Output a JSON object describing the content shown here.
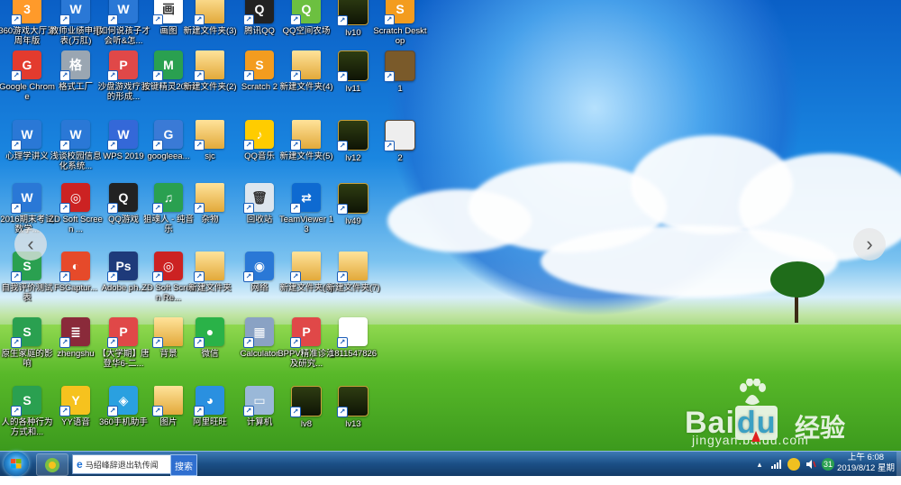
{
  "desktop_icons": [
    {
      "label": "360游戏大厅五周年版",
      "color": "#ff9a2a",
      "glyph": "3"
    },
    {
      "label": "教师业绩申报表(万肛)",
      "color": "#2a78d6",
      "glyph": "W"
    },
    {
      "label": "[如何说孩子才会听&怎...",
      "color": "#2a78d6",
      "glyph": "W"
    },
    {
      "label": "画图",
      "color": "#ffffff",
      "glyph": "画"
    },
    {
      "label": "新建文件夹(3)",
      "color": "#f3c95c",
      "glyph": ""
    },
    {
      "label": "腾讯QQ",
      "color": "#222222",
      "glyph": "Q"
    },
    {
      "label": "QQ空间农场",
      "color": "#6cc040",
      "glyph": "Q"
    },
    {
      "label": "lv10",
      "color": "#2e3d12",
      "glyph": ""
    },
    {
      "label": "Scratch Desktop",
      "color": "#f39c1f",
      "glyph": "S"
    },
    {
      "label": "Google Chrome",
      "color": "#e33b2e",
      "glyph": "G"
    },
    {
      "label": "格式工厂",
      "color": "#9aa6b2",
      "glyph": "格"
    },
    {
      "label": "沙盘游戏疗法的形成...",
      "color": "#e04848",
      "glyph": "P"
    },
    {
      "label": "按键精灵2014",
      "color": "#2aa050",
      "glyph": "M"
    },
    {
      "label": "新建文件夹(2)",
      "color": "#f3c95c",
      "glyph": ""
    },
    {
      "label": "Scratch 2",
      "color": "#f39c1f",
      "glyph": "S"
    },
    {
      "label": "新建文件夹(4)",
      "color": "#f3c95c",
      "glyph": ""
    },
    {
      "label": "lv11",
      "color": "#2e3d12",
      "glyph": ""
    },
    {
      "label": "1",
      "color": "#7a5a2a",
      "glyph": ""
    },
    {
      "label": "心理学讲义",
      "color": "#2a78d6",
      "glyph": "W"
    },
    {
      "label": "浅谈校园信息化系统...",
      "color": "#2a78d6",
      "glyph": "W"
    },
    {
      "label": "WPS 2019",
      "color": "#3468d8",
      "glyph": "W"
    },
    {
      "label": "googleea...",
      "color": "#3a7ad6",
      "glyph": "G"
    },
    {
      "label": "sjc",
      "color": "#f3c95c",
      "glyph": ""
    },
    {
      "label": "QQ音乐",
      "color": "#ffcc00",
      "glyph": "♪"
    },
    {
      "label": "新建文件夹(5)",
      "color": "#f3c95c",
      "glyph": ""
    },
    {
      "label": "lv12",
      "color": "#2e3d12",
      "glyph": ""
    },
    {
      "label": "2",
      "color": "#eeeeee",
      "glyph": ""
    },
    {
      "label": "2016期末考试数学...",
      "color": "#2a78d6",
      "glyph": "W"
    },
    {
      "label": "ZD Soft Screen ...",
      "color": "#cc2222",
      "glyph": "◎"
    },
    {
      "label": "QQ游戏",
      "color": "#222222",
      "glyph": "Q"
    },
    {
      "label": "狙魂人 - 纯音乐",
      "color": "#2aa050",
      "glyph": "♫"
    },
    {
      "label": "杂物",
      "color": "#f3c95c",
      "glyph": ""
    },
    {
      "label": "回收站",
      "color": "#dde6ee",
      "glyph": "🗑"
    },
    {
      "label": "TeamViewer 13",
      "color": "#0e6ad1",
      "glyph": "⇄"
    },
    {
      "label": "lv49",
      "color": "#2e3d12",
      "glyph": ""
    },
    {
      "label": "自我评价测试表",
      "color": "#2aa050",
      "glyph": "S"
    },
    {
      "label": "FSCaptur...",
      "color": "#e64a2a",
      "glyph": "◐"
    },
    {
      "label": "Adobe ph...",
      "color": "#1e3a7a",
      "glyph": "Ps"
    },
    {
      "label": "ZD Soft Screen Re...",
      "color": "#cc2222",
      "glyph": "◎"
    },
    {
      "label": "新建文件夹",
      "color": "#f3c95c",
      "glyph": ""
    },
    {
      "label": "网络",
      "color": "#2a78d6",
      "glyph": "◉"
    },
    {
      "label": "新建文件夹(6)",
      "color": "#f3c95c",
      "glyph": ""
    },
    {
      "label": "新建文件夹(7)",
      "color": "#f3c95c",
      "glyph": ""
    },
    {
      "label": "原生家庭的影响",
      "color": "#2aa050",
      "glyph": "S"
    },
    {
      "label": "zhengshu",
      "color": "#8a2a3a",
      "glyph": "≣"
    },
    {
      "label": "【大学期】唐登华6-二...",
      "color": "#e04848",
      "glyph": "P"
    },
    {
      "label": "背景",
      "color": "#f3c95c",
      "glyph": ""
    },
    {
      "label": "微信",
      "color": "#2ab248",
      "glyph": "●"
    },
    {
      "label": "Calculator",
      "color": "#8aa2c4",
      "glyph": "▦"
    },
    {
      "label": "BPPV精准诊治及研究...",
      "color": "#e04848",
      "glyph": "P"
    },
    {
      "label": "1811547826",
      "color": "#ffffff",
      "glyph": ""
    },
    {
      "label": "人的各种行为方式和...",
      "color": "#2aa050",
      "glyph": "S"
    },
    {
      "label": "YY语音",
      "color": "#f6c21e",
      "glyph": "Y"
    },
    {
      "label": "360手机助手",
      "color": "#2aa0e0",
      "glyph": "◈"
    },
    {
      "label": "图片",
      "color": "#f3c95c",
      "glyph": ""
    },
    {
      "label": "阿里旺旺",
      "color": "#2a90e0",
      "glyph": "◕"
    },
    {
      "label": "计算机",
      "color": "#9ab8d8",
      "glyph": "▭"
    },
    {
      "label": "lv8",
      "color": "#2e3d12",
      "glyph": ""
    },
    {
      "label": "lv13",
      "color": "#2e3d12",
      "glyph": ""
    }
  ],
  "watermark": {
    "brand": "Bai",
    "brand_du": "du",
    "brand_cn": "经验",
    "url": "jingyan.baidu.com"
  },
  "taskbar": {
    "search_text": "马绍峰辞退出轨传闻",
    "search_button": "搜索",
    "tray_date_badge": "31",
    "clock_time": "上午 6:08",
    "clock_date": "2019/8/12 星期一"
  }
}
